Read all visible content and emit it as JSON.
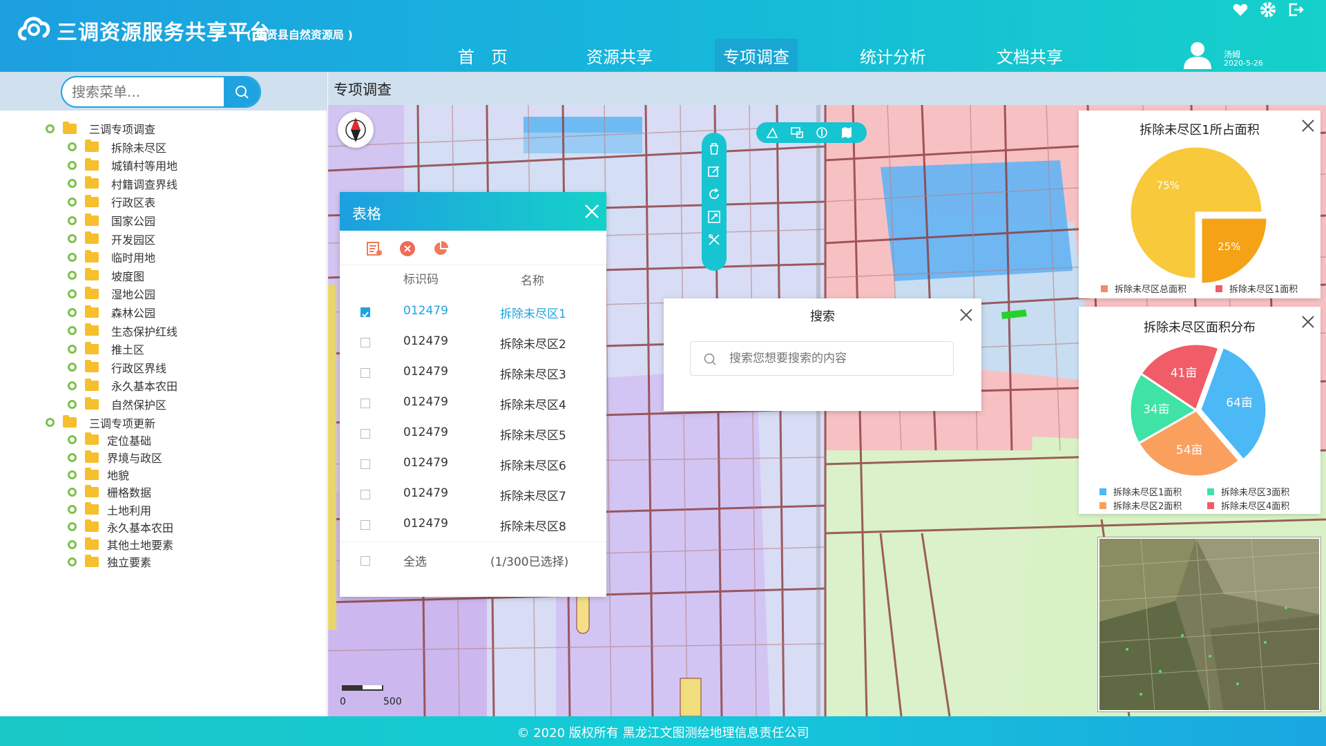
{
  "header": {
    "title": "三调资源服务共享平台",
    "subtitle": "( 集贤县自然资源局 )",
    "nav": [
      "首　页",
      "资源共享",
      "专项调查",
      "统计分析",
      "文档共享"
    ],
    "active_nav": 2,
    "icons": [
      "heart-icon",
      "gear-icon",
      "logout-icon"
    ],
    "user": {
      "name": "汤姆",
      "date": "2020-5-26"
    }
  },
  "sidebar": {
    "search_placeholder": "搜索菜单...",
    "tree": [
      {
        "label": "三调专项调查",
        "level": 0
      },
      {
        "label": "拆除未尽区",
        "level": 1
      },
      {
        "label": "城镇村等用地",
        "level": 1
      },
      {
        "label": "村籍调查界线",
        "level": 1
      },
      {
        "label": "行政区表",
        "level": 1
      },
      {
        "label": "国家公园",
        "level": 1
      },
      {
        "label": "开发园区",
        "level": 1
      },
      {
        "label": "临时用地",
        "level": 1
      },
      {
        "label": "坡度图",
        "level": 1
      },
      {
        "label": "湿地公园",
        "level": 1
      },
      {
        "label": "森林公园",
        "level": 1
      },
      {
        "label": "生态保护红线",
        "level": 1
      },
      {
        "label": "推土区",
        "level": 1
      },
      {
        "label": "行政区界线",
        "level": 1
      },
      {
        "label": "永久基本农田",
        "level": 1
      },
      {
        "label": "自然保护区",
        "level": 1
      },
      {
        "label": "三调专项更新",
        "level": 0
      },
      {
        "label": "定位基础",
        "level": 1
      },
      {
        "label": "界境与政区",
        "level": 1
      },
      {
        "label": "地貌",
        "level": 1
      },
      {
        "label": "栅格数据",
        "level": 1
      },
      {
        "label": "土地利用",
        "level": 1
      },
      {
        "label": "永久基本农田",
        "level": 1
      },
      {
        "label": "其他土地要素",
        "level": 1
      },
      {
        "label": "独立要素",
        "level": 1
      }
    ]
  },
  "content": {
    "title": "专项调查"
  },
  "table_panel": {
    "title": "表格",
    "col_code": "标识码",
    "col_name": "名称",
    "rows": [
      {
        "code": "012479",
        "name": "拆除未尽区1",
        "checked": true
      },
      {
        "code": "012479",
        "name": "拆除未尽区2",
        "checked": false
      },
      {
        "code": "012479",
        "name": "拆除未尽区3",
        "checked": false
      },
      {
        "code": "012479",
        "name": "拆除未尽区4",
        "checked": false
      },
      {
        "code": "012479",
        "name": "拆除未尽区5",
        "checked": false
      },
      {
        "code": "012479",
        "name": "拆除未尽区6",
        "checked": false
      },
      {
        "code": "012479",
        "name": "拆除未尽区7",
        "checked": false
      },
      {
        "code": "012479",
        "name": "拆除未尽区8",
        "checked": false
      }
    ],
    "select_all": "全选",
    "selection_status": "(1/300已选择)"
  },
  "search_dialog": {
    "title": "搜索",
    "placeholder": "搜索您想要搜索的内容"
  },
  "scale_bar": {
    "start": "0",
    "end": "500"
  },
  "footer": {
    "text": "© 2020 版权所有 黑龙江文图测绘地理信息责任公司"
  },
  "colors": {
    "accent": "#1fa3e0",
    "teal": "#15d1c9"
  },
  "chart_data": [
    {
      "type": "pie",
      "title": "拆除未尽区1所占面积",
      "slices": [
        {
          "name": "拆除未尽区总面积",
          "value": 75,
          "label": "75%",
          "color": "#f8c93a"
        },
        {
          "name": "拆除未尽区1面积",
          "value": 25,
          "label": "25%",
          "color": "#f5a216"
        }
      ],
      "legend": [
        {
          "name": "拆除未尽区总面积",
          "color": "#f08a6a"
        },
        {
          "name": "拆除未尽区1面积",
          "color": "#ef5b6b"
        }
      ]
    },
    {
      "type": "pie",
      "title": "拆除未尽区面积分布",
      "slices": [
        {
          "name": "拆除未尽区1面积",
          "value": 64,
          "label": "64亩",
          "color": "#4cb8f5"
        },
        {
          "name": "拆除未尽区2面积",
          "value": 54,
          "label": "54亩",
          "color": "#f9a05e"
        },
        {
          "name": "拆除未尽区3面积",
          "value": 34,
          "label": "34亩",
          "color": "#3ee3a5"
        },
        {
          "name": "拆除未尽区4面积",
          "value": 41,
          "label": "41亩",
          "color": "#f05c68"
        }
      ]
    }
  ]
}
